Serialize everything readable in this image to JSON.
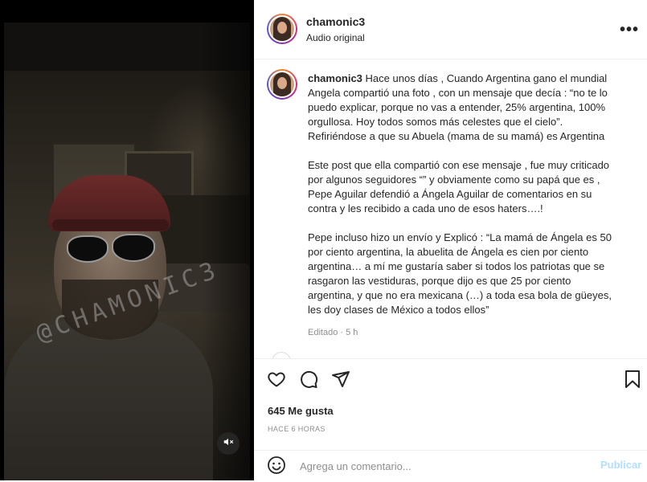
{
  "post": {
    "username": "chamonic3",
    "audio": "Audio original",
    "watermark": "@CHAMONIC3",
    "caption_paragraphs": [
      "Hace unos días , Cuando Argentina gano el mundial\nAngela compartió una foto , con un mensaje que decía : “no te lo\npuedo explicar, porque no vas a entender, 25% argentina, 100%\norgullosa. Hoy todos somos más celestes que el cielo”.\nRefiriéndose a que su Abuela (mama de su mamá) es Argentina",
      "Este post que ella compartió con ese mensaje , fue muy criticado\npor algunos seguidores “” y obviamente como su papá que es ,\nPepe Aguilar defendió a Ángela Aguilar de comentarios en su\ncontra y les recibido a cada uno de esos haters….!",
      "Pepe incluso hizo un envío y Explicó : “La mamá de Ángela es 50\npor ciento argentina, la abuelita de Ángela es cien por ciento\nargentina… a mí me gustaría saber si todos los patriotas que se\nrasgaron las vestiduras, porque dijo es que 25 por ciento\nargentina, y que no era mexicana (…) a toda esa bola de güeyes,\nles doy clases de México a todos ellos”"
    ],
    "edited": "Editado",
    "edited_time": "5 h",
    "likes": "645 Me gusta",
    "posted_ago": "HACE 6 HORAS"
  },
  "comment": {
    "placeholder": "Agrega un comentario...",
    "publish_label": "Publicar"
  },
  "icons": {
    "more": "more-options-icon",
    "like": "heart-icon",
    "comment": "comment-icon",
    "share": "paper-plane-icon",
    "save": "bookmark-icon",
    "emoji": "emoji-icon",
    "mute": "speaker-muted-icon"
  },
  "colors": {
    "publish_disabled": "#b2dffc",
    "muted_text": "#8e8e8e",
    "ring_gradient": [
      "#f58529",
      "#dd2a7b",
      "#8134af",
      "#515bd4"
    ]
  }
}
